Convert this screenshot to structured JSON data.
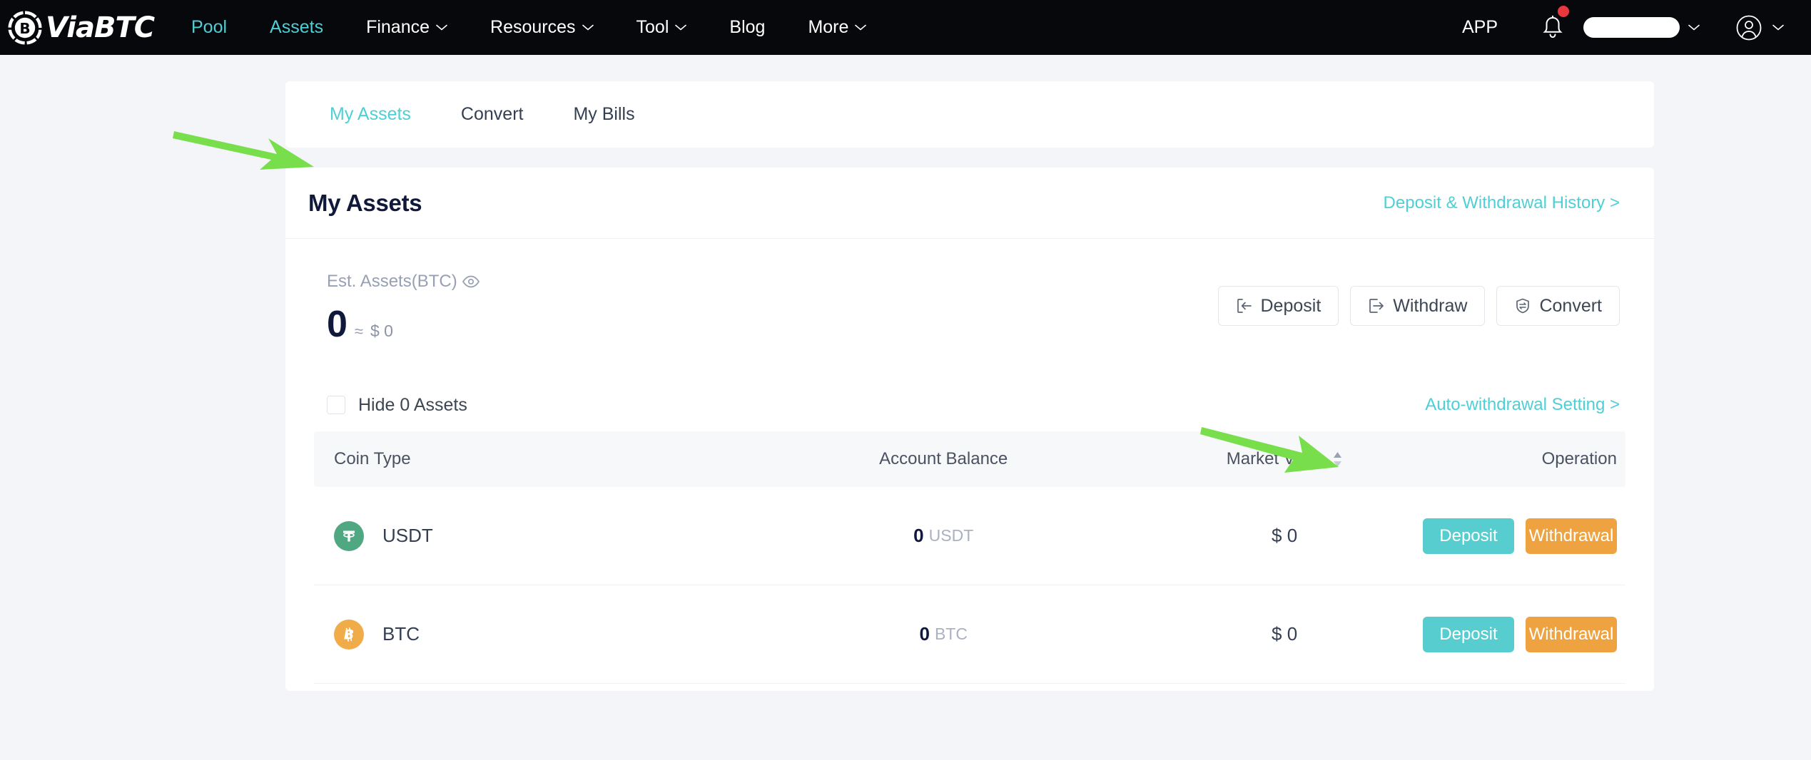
{
  "brand": {
    "name": "ViaBTC",
    "logo_icon": "bitcoin-logo-icon"
  },
  "nav": {
    "items": [
      {
        "label": "Pool",
        "has_caret": false,
        "active": false
      },
      {
        "label": "Assets",
        "has_caret": false,
        "active": true
      },
      {
        "label": "Finance",
        "has_caret": true,
        "active": false
      },
      {
        "label": "Resources",
        "has_caret": true,
        "active": false
      },
      {
        "label": "Tool",
        "has_caret": true,
        "active": false
      },
      {
        "label": "Blog",
        "has_caret": false,
        "active": false
      },
      {
        "label": "More",
        "has_caret": true,
        "active": false
      }
    ],
    "app_label": "APP",
    "bell_icon": "notification-bell-icon",
    "bell_badge": true,
    "language_selector_value": "",
    "account_icon": "user-avatar-icon"
  },
  "tabs": [
    {
      "label": "My Assets",
      "active": true
    },
    {
      "label": "Convert",
      "active": false
    },
    {
      "label": "My Bills",
      "active": false
    }
  ],
  "assets_card": {
    "title": "My Assets",
    "history_link": "Deposit & Withdrawal History >",
    "est_label": "Est. Assets(BTC)",
    "eye_icon": "eye-visibility-icon",
    "est_value": "0",
    "approx_symbol": "≈",
    "est_usd": "$ 0",
    "actions": [
      {
        "label": "Deposit",
        "icon": "arrow-into-box-icon"
      },
      {
        "label": "Withdraw",
        "icon": "arrow-out-of-box-icon"
      },
      {
        "label": "Convert",
        "icon": "shield-convert-icon"
      }
    ],
    "hide_assets_label": "Hide 0 Assets",
    "hide_assets_checked": false,
    "auto_withdrawal_link": "Auto-withdrawal Setting >"
  },
  "table": {
    "columns": [
      "Coin Type",
      "Account Balance",
      "Market Value",
      "Operation"
    ],
    "sortable_column": "Market Value",
    "sort_icon": "sort-updown-icon",
    "rows": [
      {
        "coin": "USDT",
        "coin_icon": "usdt-tether-icon",
        "balance": "0",
        "balance_unit": "USDT",
        "market_value": "$ 0",
        "deposit_label": "Deposit",
        "withdrawal_label": "Withdrawal"
      },
      {
        "coin": "BTC",
        "coin_icon": "btc-bitcoin-icon",
        "balance": "0",
        "balance_unit": "BTC",
        "market_value": "$ 0",
        "deposit_label": "Deposit",
        "withdrawal_label": "Withdrawal"
      }
    ]
  },
  "annotations": [
    {
      "name": "arrow-to-my-assets-tab",
      "color": "#79de4b"
    },
    {
      "name": "arrow-to-auto-withdrawal-setting",
      "color": "#79de4b"
    }
  ],
  "colors": {
    "accent_teal": "#4ecfd6",
    "button_teal": "#58cdd0",
    "button_orange": "#efa340",
    "nav_bg": "#06080c",
    "page_bg": "#f4f5f8",
    "annotation_green": "#79de4b",
    "badge_red": "#e8383d"
  }
}
